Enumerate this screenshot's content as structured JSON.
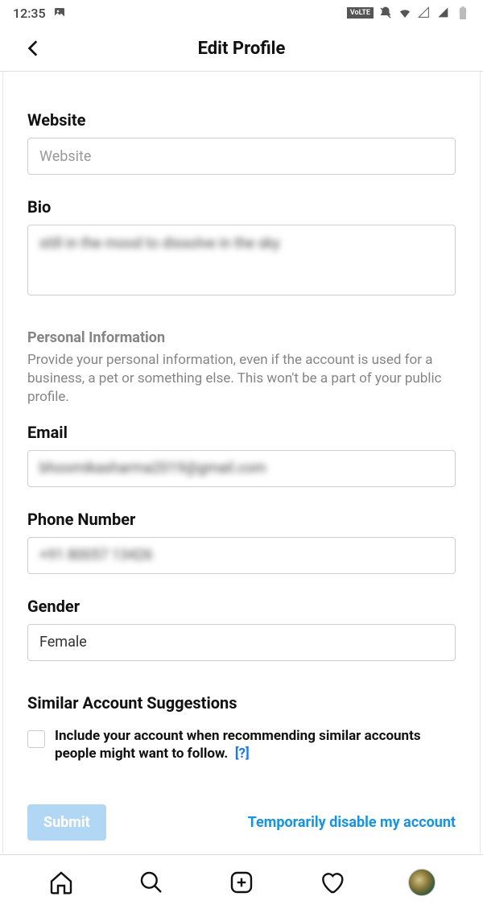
{
  "status": {
    "time": "12:35",
    "volte": "VoLTE"
  },
  "header": {
    "title": "Edit Profile"
  },
  "fields": {
    "website": {
      "label": "Website",
      "placeholder": "Website",
      "value": ""
    },
    "bio": {
      "label": "Bio",
      "value": "still in the mood to dissolve in the sky"
    },
    "email": {
      "label": "Email",
      "value": "bhoomikasharma2019@gmail.com"
    },
    "phone": {
      "label": "Phone Number",
      "value": "+91 80057 13426"
    },
    "gender": {
      "label": "Gender",
      "value": "Female"
    }
  },
  "personal_info": {
    "heading": "Personal Information",
    "description": "Provide your personal information, even if the account is used for a business, a pet or something else. This won't be a part of your public profile."
  },
  "suggestions": {
    "heading": "Similar Account Suggestions",
    "checkbox_label": "Include your account when recommending similar accounts people might want to follow.",
    "help": "[?]"
  },
  "actions": {
    "submit": "Submit",
    "disable_link": "Temporarily disable my account"
  }
}
